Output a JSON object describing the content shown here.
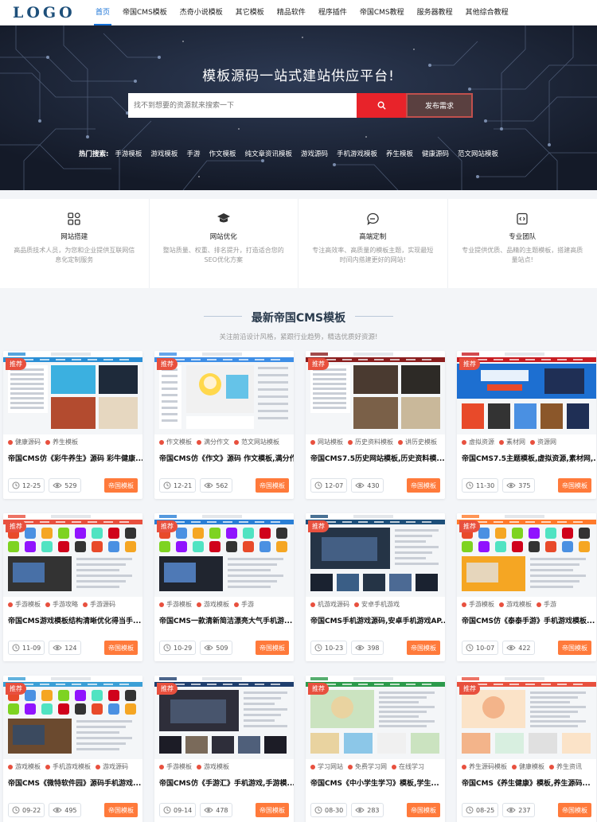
{
  "header": {
    "logo": "LOGO",
    "nav": [
      "首页",
      "帝国CMS模板",
      "杰奇小说模板",
      "其它模板",
      "精品软件",
      "程序插件",
      "帝国CMS教程",
      "服务器教程",
      "其他综合教程"
    ]
  },
  "banner": {
    "title": "模板源码一站式建站供应平台!",
    "search_placeholder": "找不到想要的资源就来搜索一下",
    "publish_label": "发布需求",
    "hot_label": "热门搜索:",
    "hot_items": [
      "手游模板",
      "游戏模板",
      "手游",
      "作文模板",
      "纯文章资讯模板",
      "游戏源码",
      "手机游戏模板",
      "养生模板",
      "健康源码",
      "范文网站模板"
    ]
  },
  "features": [
    {
      "icon": "grid-apps-icon",
      "title": "网站搭建",
      "desc": "高品质技术人员，为您和企业提供互联网信息化定制服务"
    },
    {
      "icon": "graduation-cap-icon",
      "title": "网站优化",
      "desc": "整站质量、权重、排名提升，打造适合您的SEO优化方案"
    },
    {
      "icon": "chat-bubble-icon",
      "title": "高端定制",
      "desc": "专注高效率、高质量的模板主题，实现最短时间内搭建更好的网站!"
    },
    {
      "icon": "code-file-icon",
      "title": "专业团队",
      "desc": "专业提供优质、品精的主题模板，搭建高质量站点!"
    }
  ],
  "section": {
    "title": "最新帝国CMS模板",
    "subtitle": "关注前沿设计风格，紧跟行业趋势，精选优质好资源!"
  },
  "cards": [
    {
      "badge": "推荐",
      "tags": [
        "健康源码",
        "养生模板"
      ],
      "title": "帝国CMS仿《彩牛养生》源码 彩牛健康...",
      "date": "12-25",
      "views": "529",
      "category": "帝国模板"
    },
    {
      "badge": "推荐",
      "tags": [
        "作文模板",
        "满分作文",
        "范文网站模板"
      ],
      "title": "帝国CMS仿《作文》源码 作文模板,满分作...",
      "date": "12-21",
      "views": "562",
      "category": "帝国模板"
    },
    {
      "badge": "推荐",
      "tags": [
        "网站模板",
        "历史资料模板",
        "讲历史模板"
      ],
      "title": "帝国CMS7.5历史网站模板,历史资料模...",
      "date": "12-07",
      "views": "430",
      "category": "帝国模板"
    },
    {
      "badge": "推荐",
      "tags": [
        "虚拟资源",
        "素材网",
        "资源网"
      ],
      "title": "帝国CMS7.5主题模板,虚拟资源,素材网,...",
      "date": "11-30",
      "views": "375",
      "category": "帝国模板"
    },
    {
      "badge": "推荐",
      "tags": [
        "手游模板",
        "手游攻略",
        "手游源码"
      ],
      "title": "帝国CMS游戏模板结构清晰优化得当手...",
      "date": "11-09",
      "views": "124",
      "category": "帝国模板"
    },
    {
      "badge": "推荐",
      "tags": [
        "手游模板",
        "游戏模板",
        "手游"
      ],
      "title": "帝国CMS一款清新简洁漂亮大气手机游...",
      "date": "10-29",
      "views": "509",
      "category": "帝国模板"
    },
    {
      "badge": "推荐",
      "tags": [
        "机游戏源码",
        "安卓手机游戏"
      ],
      "title": "帝国CMS手机游戏源码,安卓手机游戏AP...",
      "date": "10-23",
      "views": "398",
      "category": "帝国模板"
    },
    {
      "badge": "推荐",
      "tags": [
        "手游模板",
        "游戏模板",
        "手游"
      ],
      "title": "帝国CMS仿《泰泰手游》手机游戏模板...",
      "date": "10-07",
      "views": "422",
      "category": "帝国模板"
    },
    {
      "badge": "推荐",
      "tags": [
        "游戏模板",
        "手机游戏模板",
        "游戏源码"
      ],
      "title": "帝国CMS《微特软件园》源码手机游戏...",
      "date": "09-22",
      "views": "495",
      "category": "帝国模板"
    },
    {
      "badge": "推荐",
      "tags": [
        "手游模板",
        "游戏模板"
      ],
      "title": "帝国CMS仿《手游汇》手机游戏,手游模...",
      "date": "09-14",
      "views": "478",
      "category": "帝国模板"
    },
    {
      "badge": "推荐",
      "tags": [
        "学习网站",
        "免费学习网",
        "在线学习"
      ],
      "title": "帝国CMS《中小学生学习》模板,学生...",
      "date": "08-30",
      "views": "283",
      "category": "帝国模板"
    },
    {
      "badge": "推荐",
      "tags": [
        "养生源码模板",
        "健康模板",
        "养生资讯"
      ],
      "title": "帝国CMS《养生健康》模板,养生源码...",
      "date": "08-25",
      "views": "237",
      "category": "帝国模板"
    }
  ],
  "colors": {
    "brand": "#1d4f7a",
    "nav_active": "#1570d6",
    "accent": "#e8232a",
    "orange": "#ff7a3b",
    "badge": "#e8503e"
  }
}
